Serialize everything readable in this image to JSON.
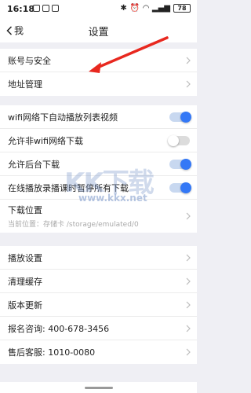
{
  "status": {
    "time": "16:18",
    "battery": "78"
  },
  "nav": {
    "back_label": "我",
    "title": "设置"
  },
  "account": [
    {
      "label": "账号与安全"
    },
    {
      "label": "地址管理"
    }
  ],
  "download": {
    "wifi_autoplay": {
      "label": "wifi网络下自动播放列表视频",
      "enabled": true
    },
    "non_wifi": {
      "label": "允许非wifi网络下载",
      "enabled": false
    },
    "background": {
      "label": "允许后台下载",
      "enabled": true
    },
    "pause_on_play": {
      "label": "在线播放录播课时暂停所有下载",
      "enabled": true
    },
    "location": {
      "label": "下载位置",
      "current": "当前位置：存储卡 /storage/emulated/0"
    }
  },
  "other": {
    "playback": "播放设置",
    "clear_cache": "清理缓存",
    "version": "版本更新",
    "consult": "报名咨询: 400-678-3456",
    "service": "售后客服: 1010-0080"
  },
  "watermark": {
    "big": "KK下载",
    "url": "www.kkx.net"
  },
  "colors": {
    "accent": "#3478f6",
    "arrow": "#e8281f"
  }
}
